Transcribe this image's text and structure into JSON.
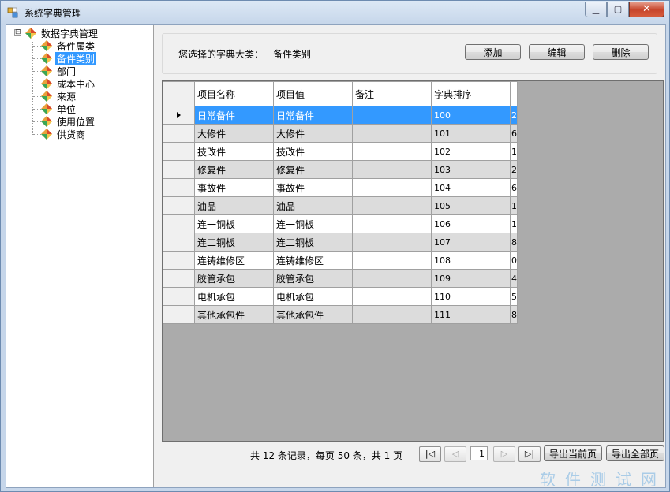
{
  "window": {
    "title": "系统字典管理",
    "controls": {
      "minimize": "▁",
      "maximize": "▢",
      "close": "✕"
    }
  },
  "tree": {
    "root": "数据字典管理",
    "expander": "⊟",
    "items": [
      "备件属类",
      "备件类别",
      "部门",
      "成本中心",
      "来源",
      "单位",
      "使用位置",
      "供货商"
    ],
    "selected_index": 1
  },
  "selection": {
    "label": "您选择的字典大类：",
    "value": "备件类别"
  },
  "toolbar": {
    "add": "添加",
    "edit": "编辑",
    "delete": "删除"
  },
  "grid": {
    "columns": [
      "项目名称",
      "项目值",
      "备注",
      "字典排序"
    ],
    "rows": [
      [
        "日常备件",
        "日常备件",
        "",
        "100",
        "2"
      ],
      [
        "大修件",
        "大修件",
        "",
        "101",
        "6"
      ],
      [
        "技改件",
        "技改件",
        "",
        "102",
        "1"
      ],
      [
        "修复件",
        "修复件",
        "",
        "103",
        "2"
      ],
      [
        "事故件",
        "事故件",
        "",
        "104",
        "6"
      ],
      [
        "油品",
        "油品",
        "",
        "105",
        "1"
      ],
      [
        "连一铜板",
        "连一铜板",
        "",
        "106",
        "1"
      ],
      [
        "连二铜板",
        "连二铜板",
        "",
        "107",
        "8"
      ],
      [
        "连铸维修区",
        "连铸维修区",
        "",
        "108",
        "0"
      ],
      [
        "胶管承包",
        "胶管承包",
        "",
        "109",
        "4"
      ],
      [
        "电机承包",
        "电机承包",
        "",
        "110",
        "5"
      ],
      [
        "其他承包件",
        "其他承包件",
        "",
        "111",
        "8"
      ]
    ],
    "selected_row": 0
  },
  "pager": {
    "summary": "共 12 条记录，每页 50 条，共 1 页",
    "first": "|◁",
    "prev": "◁",
    "page": "1",
    "next": "▷",
    "last": "▷|",
    "export_current": "导出当前页",
    "export_all": "导出全部页"
  },
  "watermark": "软件测试网",
  "colors": {
    "selection": "#3399ff",
    "grid_background": "#ababab",
    "title_gradient": "#c6d6ea"
  }
}
